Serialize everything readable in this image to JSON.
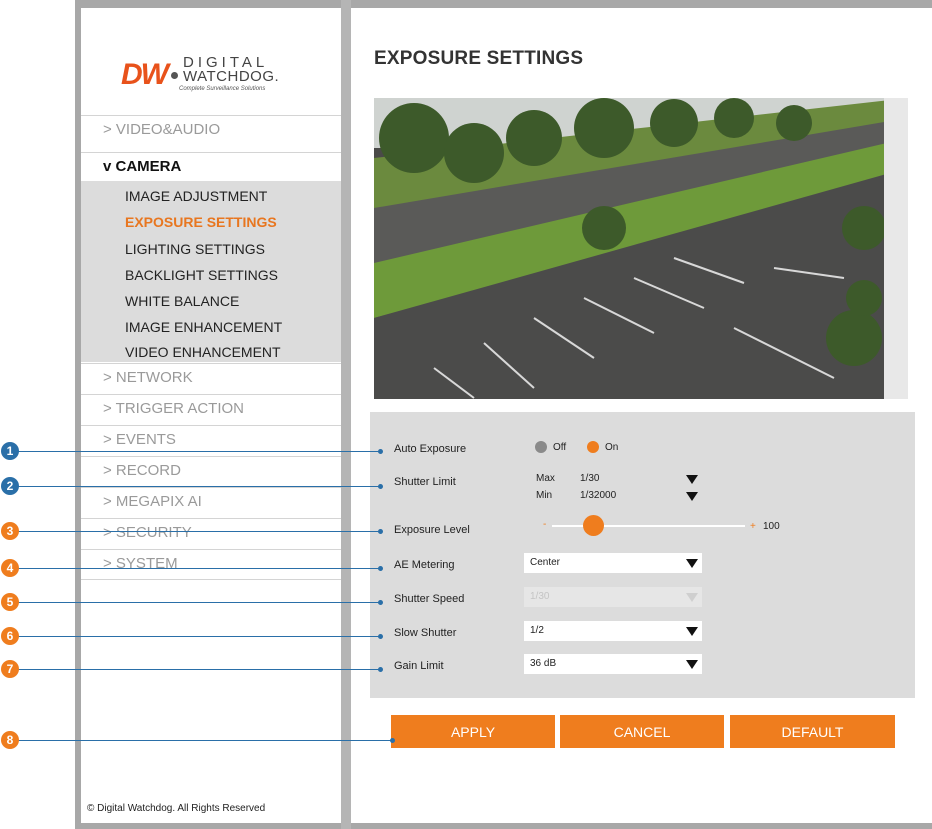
{
  "logo": {
    "brand": "DW",
    "line1": "DIGITAL",
    "line2": "WATCHDOG.",
    "tagline": "Complete Surveillance Solutions"
  },
  "nav": {
    "video_audio": "> VIDEO&AUDIO",
    "camera": "v CAMERA",
    "camera_items": [
      "IMAGE ADJUSTMENT",
      "EXPOSURE SETTINGS",
      "LIGHTING SETTINGS",
      "BACKLIGHT SETTINGS",
      "WHITE BALANCE",
      "IMAGE ENHANCEMENT",
      "VIDEO ENHANCEMENT"
    ],
    "network": "> NETWORK",
    "trigger_action": "> TRIGGER ACTION",
    "events": "> EVENTS",
    "record": "> RECORD",
    "megapix_ai": "> MEGAPIX AI",
    "security": "> SECURITY",
    "system": "> SYSTEM"
  },
  "footer": "© Digital Watchdog. All Rights Reserved",
  "page": {
    "title": "EXPOSURE SETTINGS"
  },
  "settings": {
    "auto_exposure": {
      "label": "Auto Exposure",
      "off": "Off",
      "on": "On",
      "selected": "On"
    },
    "shutter_limit": {
      "label": "Shutter Limit",
      "max_label": "Max",
      "max_value": "1/30",
      "min_label": "Min",
      "min_value": "1/32000"
    },
    "exposure_level": {
      "label": "Exposure Level",
      "minus": "-",
      "plus": "+",
      "value": "100",
      "level_fraction": 0.19
    },
    "ae_metering": {
      "label": "AE Metering",
      "value": "Center"
    },
    "shutter_speed": {
      "label": "Shutter Speed",
      "value": "1/30"
    },
    "slow_shutter": {
      "label": "Slow Shutter",
      "value": "1/2"
    },
    "gain_limit": {
      "label": "Gain Limit",
      "value": "36 dB"
    }
  },
  "buttons": {
    "apply": "APPLY",
    "cancel": "CANCEL",
    "default": "DEFAULT"
  },
  "callouts": [
    "1",
    "2",
    "3",
    "4",
    "5",
    "6",
    "7",
    "8"
  ],
  "colors": {
    "accent": "#ef7d1e",
    "callout": "#2a6fa8",
    "active_nav": "#e8761f"
  }
}
